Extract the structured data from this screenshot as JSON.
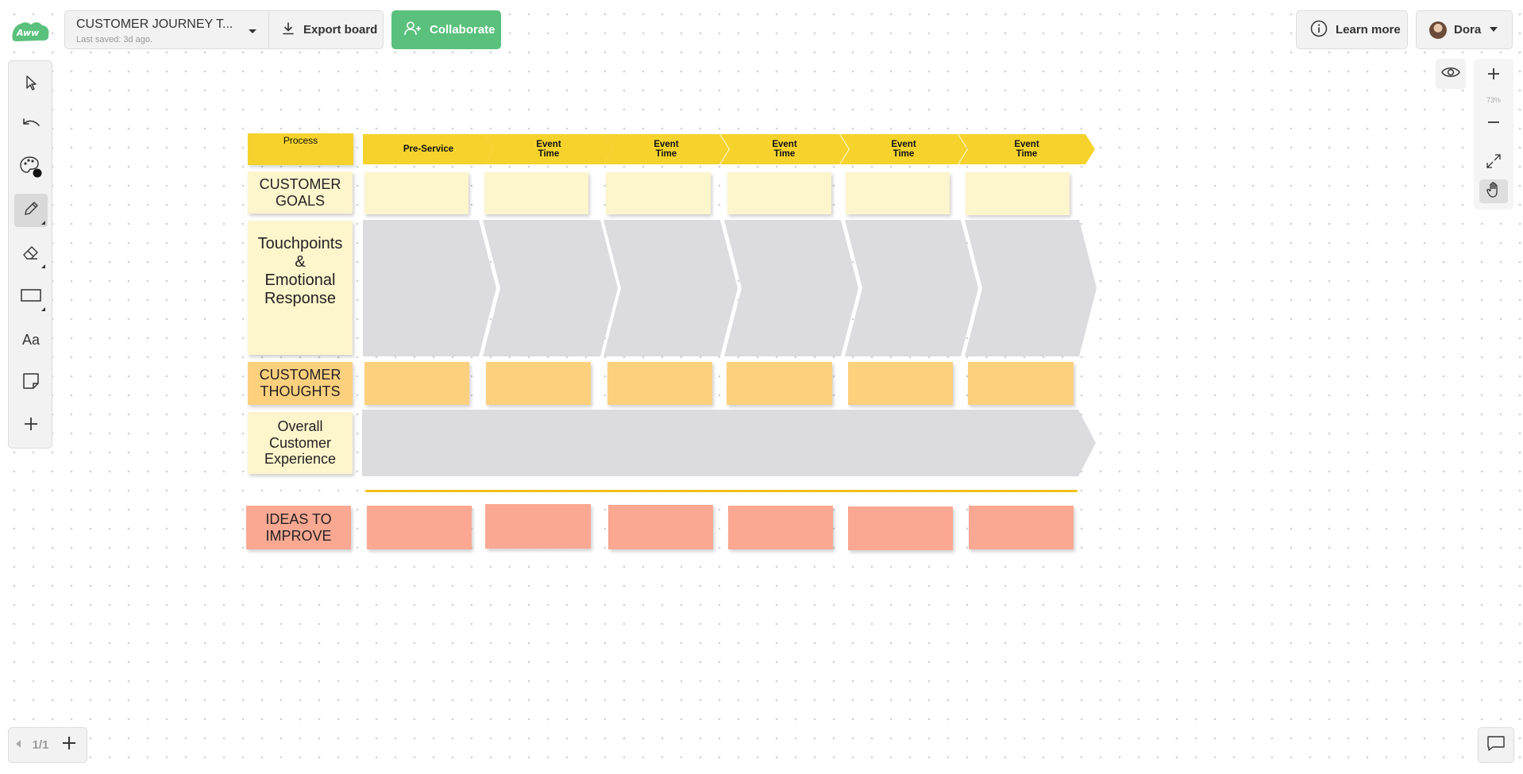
{
  "header": {
    "board_title": "CUSTOMER JOURNEY T...",
    "last_saved": "Last saved: 3d ago.",
    "export_label": "Export board",
    "collaborate_label": "Collaborate",
    "learn_more_label": "Learn more",
    "user_name": "Dora"
  },
  "toolbar": {
    "tools": [
      "select",
      "undo",
      "color-palette",
      "pen",
      "eraser",
      "rectangle",
      "text",
      "sticky-note",
      "add"
    ],
    "active_tool": "pen",
    "text_tool_label": "Aa"
  },
  "zoom": {
    "level": "73%"
  },
  "pages": {
    "indicator": "1/1"
  },
  "colors": {
    "header_yellow": "#f5d32c",
    "pale_yellow": "#fdf5cc",
    "orange": "#fdd07e",
    "salmon": "#fba892",
    "gray": "#dcdcde",
    "brand_green": "#5ac17d"
  },
  "board": {
    "process_label": "Process",
    "stages": [
      "Pre-Service",
      "Event\nTime",
      "Event\nTime",
      "Event\nTime",
      "Event\nTime",
      "Event\nTime"
    ],
    "row_labels": {
      "goals": "CUSTOMER\nGOALS",
      "touchpoints": "Touchpoints\n&\nEmotional\nResponse",
      "thoughts": "CUSTOMER\nTHOUGHTS",
      "overall": "Overall\nCustomer\nExperience",
      "ideas": "IDEAS TO\nIMPROVE"
    }
  }
}
